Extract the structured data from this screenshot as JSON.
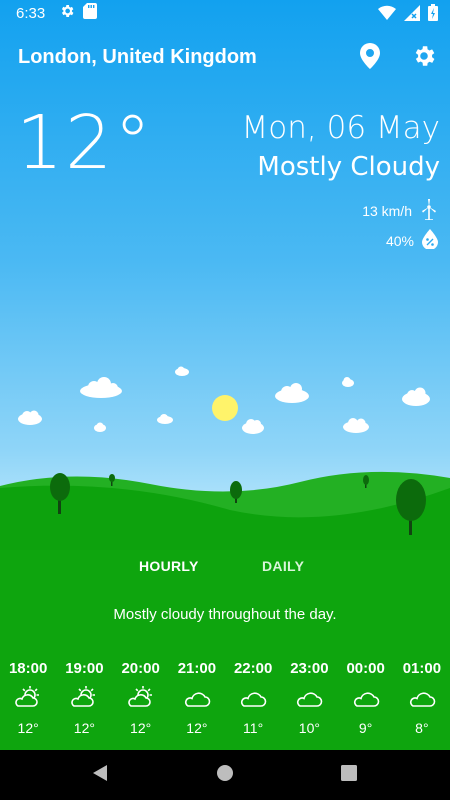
{
  "status_bar": {
    "time": "6:33"
  },
  "header": {
    "location": "London, United Kingdom"
  },
  "current": {
    "temperature": "12°",
    "date": "Mon, 06 May",
    "condition": "Mostly Cloudy",
    "wind": "13 km/h",
    "humidity": "40%"
  },
  "tabs": [
    {
      "label": "HOURLY",
      "active": true
    },
    {
      "label": "DAILY",
      "active": false
    }
  ],
  "summary": "Mostly cloudy throughout the day.",
  "hourly": [
    {
      "time": "18:00",
      "icon": "partly-cloudy-sun-icon",
      "temp": "12°"
    },
    {
      "time": "19:00",
      "icon": "partly-cloudy-sun-icon",
      "temp": "12°"
    },
    {
      "time": "20:00",
      "icon": "partly-cloudy-sun-icon",
      "temp": "12°"
    },
    {
      "time": "21:00",
      "icon": "cloudy-icon",
      "temp": "12°"
    },
    {
      "time": "22:00",
      "icon": "cloudy-icon",
      "temp": "11°"
    },
    {
      "time": "23:00",
      "icon": "cloudy-icon",
      "temp": "10°"
    },
    {
      "time": "00:00",
      "icon": "cloudy-icon",
      "temp": "9°"
    },
    {
      "time": "01:00",
      "icon": "cloudy-icon",
      "temp": "8°"
    }
  ],
  "colors": {
    "sky_top": "#12a1ef",
    "sky_bottom": "#c6ecfd",
    "grass": "#0ea50e",
    "sun": "#fff36a"
  }
}
